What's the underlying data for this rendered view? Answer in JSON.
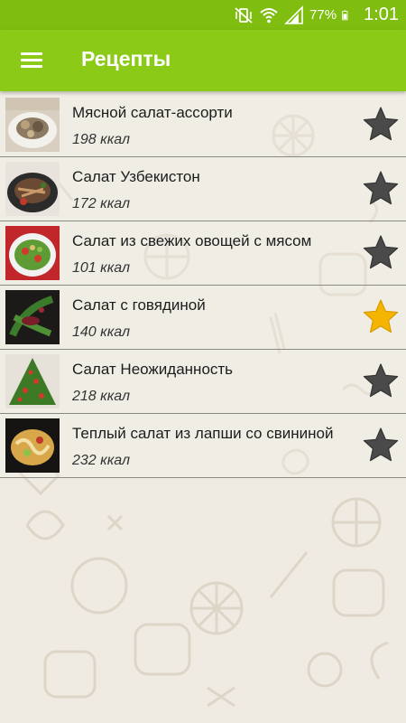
{
  "status_bar": {
    "battery": "77%",
    "time": "1:01"
  },
  "app_bar": {
    "title": "Рецепты"
  },
  "colors": {
    "status_bar": "#7fbd10",
    "app_bar": "#8cca18",
    "star_off": "#4a4a4a",
    "star_on": "#f5b400"
  },
  "recipes": [
    {
      "name": "Мясной салат-ассорти",
      "kcal": "198 ккал",
      "favorite": false
    },
    {
      "name": "Салат Узбекистон",
      "kcal": "172 ккал",
      "favorite": false
    },
    {
      "name": "Салат из свежих овощей с мясом",
      "kcal": "101 ккал",
      "favorite": false
    },
    {
      "name": "Салат с говядиной",
      "kcal": "140 ккал",
      "favorite": true
    },
    {
      "name": "Салат Неожиданность",
      "kcal": "218 ккал",
      "favorite": false
    },
    {
      "name": "Теплый салат из лапши со свининой",
      "kcal": "232 ккал",
      "favorite": false
    }
  ]
}
